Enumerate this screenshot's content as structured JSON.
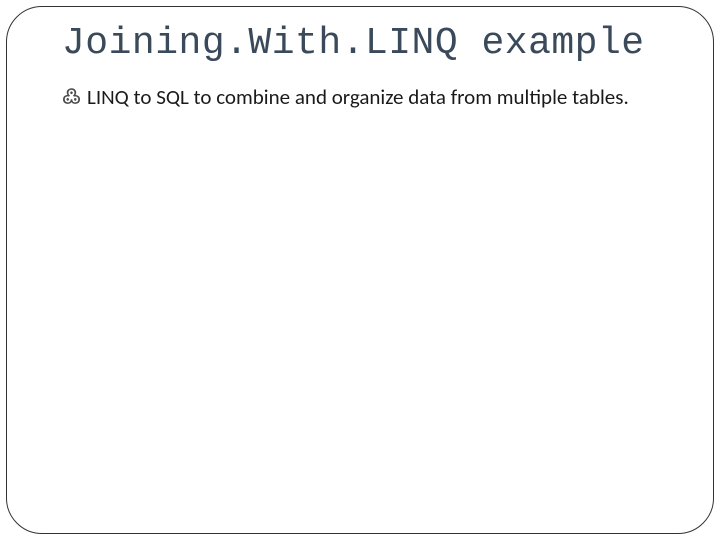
{
  "slide": {
    "title": "Joining.With.LINQ example",
    "bullets": [
      {
        "icon_char": "߷",
        "text": "LINQ to SQL to combine and organize data from multiple tables."
      }
    ]
  },
  "colors": {
    "title": "#3a4a5a",
    "text": "#1a1a1a",
    "border": "#333333"
  }
}
